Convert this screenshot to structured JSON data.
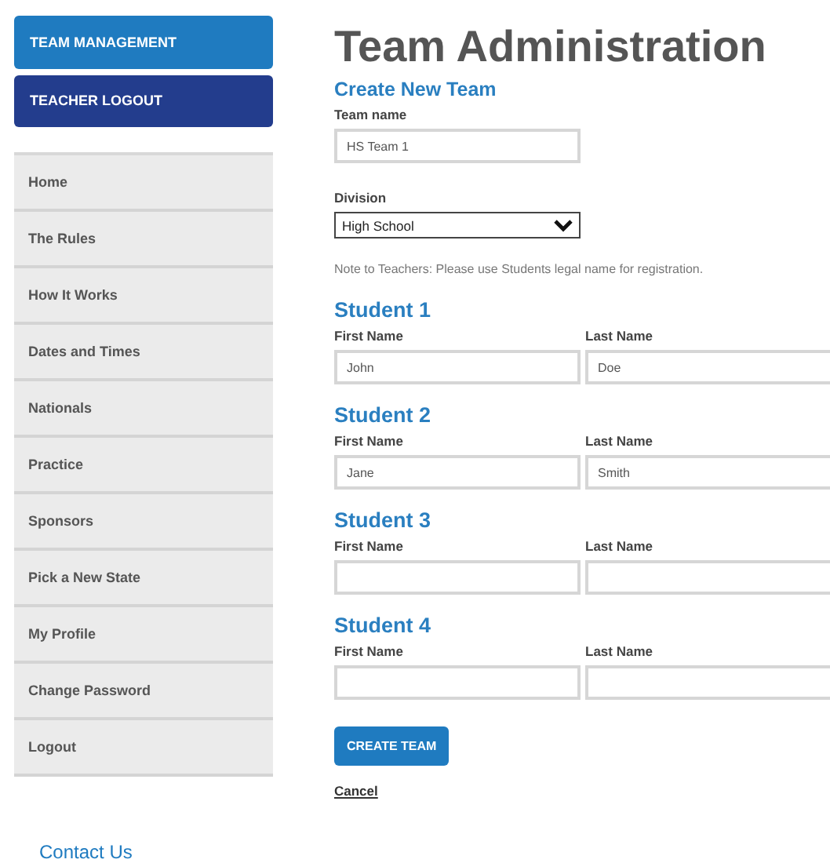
{
  "sidebar": {
    "buttons": [
      {
        "label": "TEAM MANAGEMENT",
        "kind": "primary"
      },
      {
        "label": "TEACHER LOGOUT",
        "kind": "dark"
      }
    ],
    "nav": [
      "Home",
      "The Rules",
      "How It Works",
      "Dates and Times",
      "Nationals",
      "Practice",
      "Sponsors",
      "Pick a New State",
      "My Profile",
      "Change Password",
      "Logout"
    ],
    "contact_link": "Contact Us"
  },
  "main": {
    "title": "Team Administration",
    "subtitle": "Create New Team",
    "team_name": {
      "label": "Team name",
      "value": "HS Team 1"
    },
    "division": {
      "label": "Division",
      "value": "High School"
    },
    "note": "Note to Teachers: Please use Students legal name for registration.",
    "students": [
      {
        "heading": "Student 1",
        "first_name": {
          "label": "First Name",
          "value": "John"
        },
        "last_name": {
          "label": "Last Name",
          "value": "Doe"
        }
      },
      {
        "heading": "Student 2",
        "first_name": {
          "label": "First Name",
          "value": "Jane"
        },
        "last_name": {
          "label": "Last Name",
          "value": "Smith"
        }
      },
      {
        "heading": "Student 3",
        "first_name": {
          "label": "First Name"
        },
        "last_name": {
          "label": "Last Name"
        }
      },
      {
        "heading": "Student 4",
        "first_name": {
          "label": "First Name"
        },
        "last_name": {
          "label": "Last Name"
        }
      }
    ],
    "submit_button": "CREATE TEAM",
    "cancel_link": "Cancel"
  }
}
